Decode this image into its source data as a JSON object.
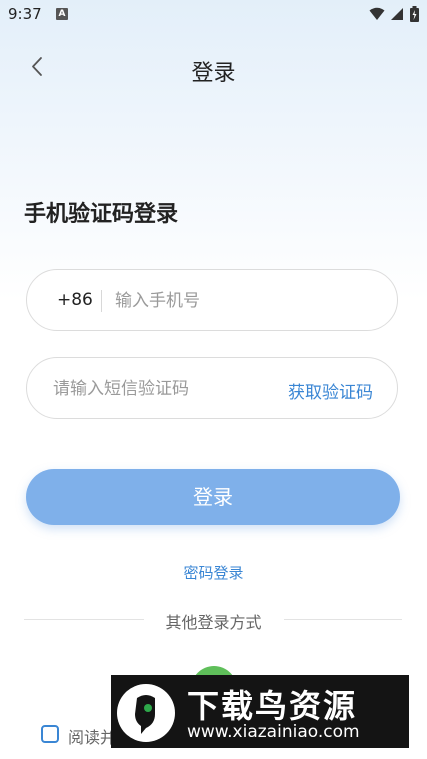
{
  "status_bar": {
    "time": "9:37",
    "notification_letter": "A",
    "icons": [
      "wifi-icon",
      "signal-icon",
      "battery-icon"
    ]
  },
  "nav": {
    "title": "登录",
    "back_icon": "chevron-left-icon"
  },
  "heading": "手机验证码登录",
  "phone_field": {
    "country_code": "+86",
    "placeholder": "输入手机号",
    "value": ""
  },
  "code_field": {
    "placeholder": "请输入短信验证码",
    "value": "",
    "get_code_label": "获取验证码"
  },
  "login_button_label": "登录",
  "password_login_label": "密码登录",
  "other_methods_label": "其他登录方式",
  "agreement": {
    "checked": false,
    "text": "阅读并"
  },
  "watermark": {
    "title": "下载鸟资源",
    "url": "www.xiazainiao.com"
  },
  "colors": {
    "accent": "#3a86d4",
    "button": "#7fb0ea",
    "wechat": "#5fbf5a"
  }
}
